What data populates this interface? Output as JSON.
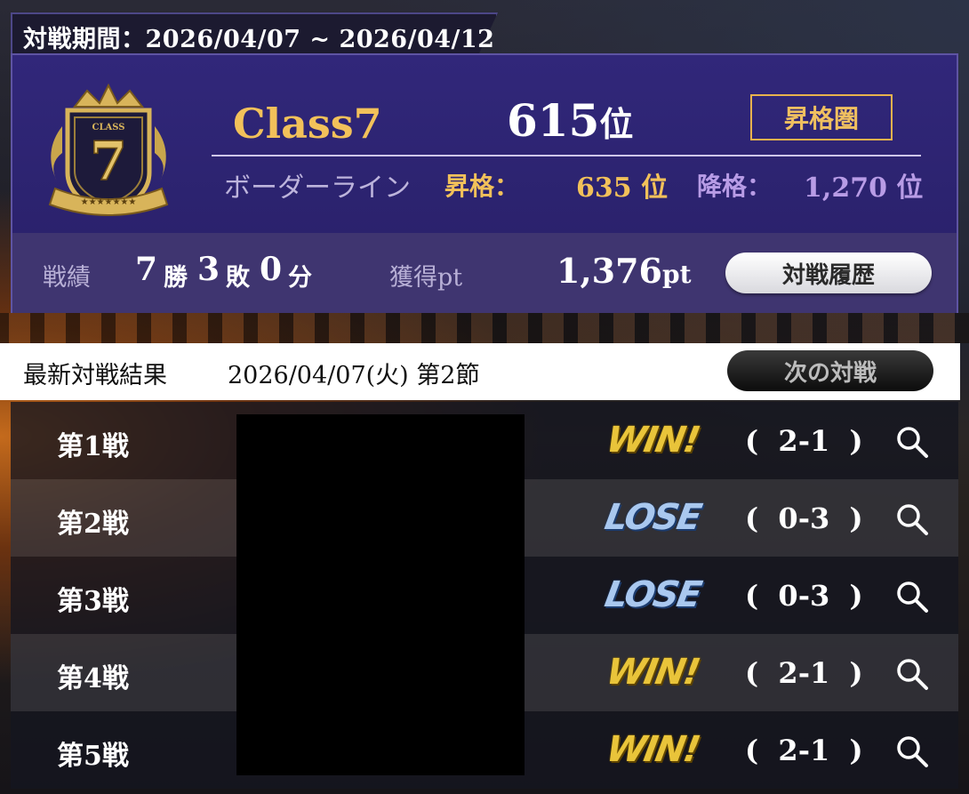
{
  "period": {
    "label": "対戦期間：2026/04/07 ~ 2026/04/12"
  },
  "class_info": {
    "emblem_text": "CLASS",
    "emblem_number": "7",
    "name": "Class7",
    "rank_number": "615",
    "rank_unit": "位",
    "status_badge": "昇格圏",
    "border_label": "ボーダーライン",
    "promotion_label": "昇格：",
    "promotion_value": "635 位",
    "demotion_label": "降格：",
    "demotion_value": "1,270 位"
  },
  "record": {
    "label": "戦績",
    "wins": "7",
    "wins_unit": "勝",
    "losses": "3",
    "losses_unit": "敗",
    "draws": "0",
    "draws_unit": "分",
    "points_label": "獲得pt",
    "points_value": "1,376",
    "points_unit": "pt",
    "history_button": "対戦履歴"
  },
  "latest": {
    "label": "最新対戦結果",
    "date": "2026/04/07(火) 第2節",
    "next_button": "次の対戦"
  },
  "matches": [
    {
      "label": "第1戦",
      "result": "WIN!",
      "score": "(  2-1  )"
    },
    {
      "label": "第2戦",
      "result": "LOSE",
      "score": "(  0-3  )"
    },
    {
      "label": "第3戦",
      "result": "LOSE",
      "score": "(  0-3  )"
    },
    {
      "label": "第4戦",
      "result": "WIN!",
      "score": "(  2-1  )"
    },
    {
      "label": "第5戦",
      "result": "WIN!",
      "score": "(  2-1  )"
    }
  ],
  "colors": {
    "panel": "#2a2266",
    "gold": "#f2c15a",
    "lavender": "#b89ce6",
    "win": "#e9c43a",
    "lose": "#a9c8ef"
  },
  "icons": {
    "detail": "magnifier-icon",
    "emblem": "class-crest-icon"
  }
}
